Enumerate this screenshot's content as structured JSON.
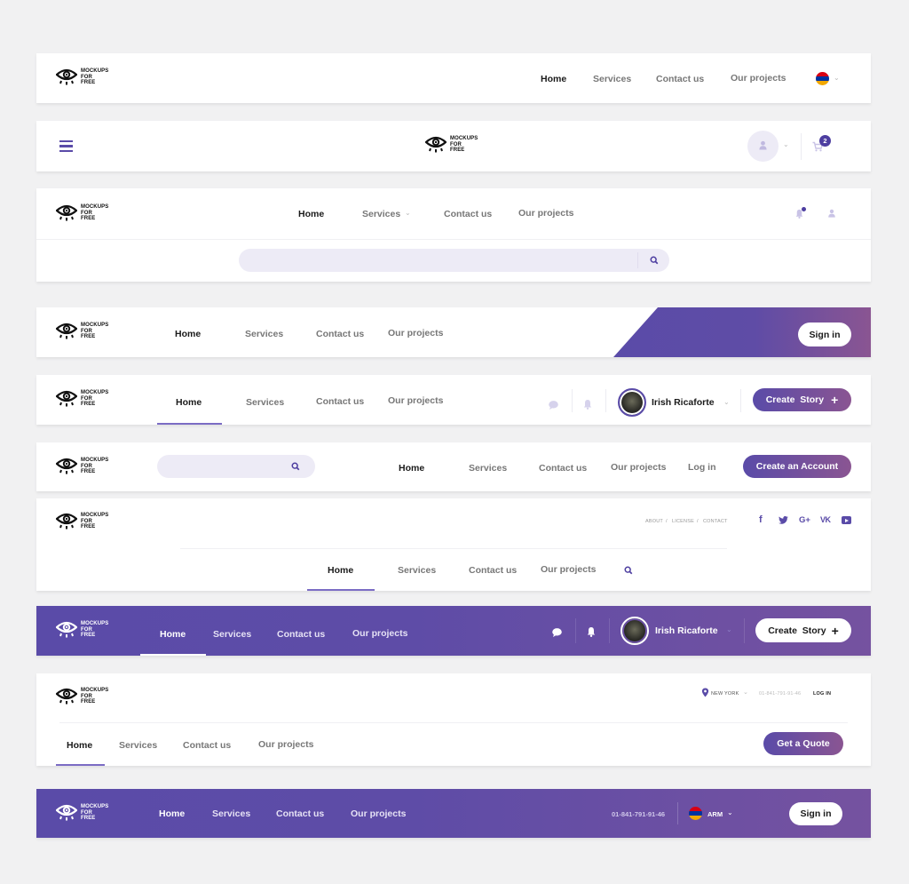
{
  "brand": {
    "logo_lines": [
      "MOCKUPS",
      "FOR",
      "FREE"
    ]
  },
  "colors": {
    "accent": "#5a4ba8",
    "accent_end": "#8a5592",
    "light_accent": "#edebf6",
    "icon_muted": "#c9c3e6"
  },
  "nav_items": [
    "Home",
    "Services",
    "Contact us",
    "Our projects"
  ],
  "header1": {
    "active": "Home",
    "language_flag": "armenia-flag"
  },
  "header2": {
    "cart_count": "2"
  },
  "header3": {
    "search_placeholder": ""
  },
  "header4": {
    "signin_label": "Sign in"
  },
  "header5": {
    "user_name": "Irish Ricaforte",
    "create_story_label": "Create  Story",
    "plus": "+"
  },
  "header6": {
    "search_placeholder": "",
    "login_label": "Log in",
    "create_account_label": "Create an Account"
  },
  "header7": {
    "top_links": [
      "ABOUT",
      "LICENSE",
      "CONTACT"
    ],
    "separator": "/",
    "social": [
      "facebook",
      "twitter",
      "google-plus",
      "vk",
      "youtube"
    ]
  },
  "header8": {
    "user_name": "Irish Ricaforte",
    "create_story_label": "Create  Story",
    "plus": "+"
  },
  "header9": {
    "location": "NEW YORK",
    "phone": "01-841-791-91-46",
    "login_label": "LOG IN",
    "quote_label": "Get a Quote"
  },
  "header10": {
    "phone": "01-841-791-91-46",
    "language": "ARM",
    "signin_label": "Sign in"
  }
}
